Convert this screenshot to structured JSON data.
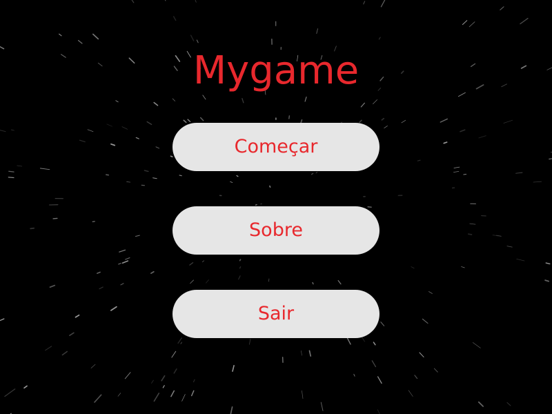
{
  "game": {
    "title": "Mygame"
  },
  "menu": {
    "start_label": "Começar",
    "about_label": "Sobre",
    "exit_label": "Sair"
  },
  "colors": {
    "background": "#000000",
    "accent": "#e8282d",
    "button_bg": "#e6e6e6",
    "star": "#ffffff"
  },
  "background": {
    "style": "radial starfield (warp streaks)"
  }
}
